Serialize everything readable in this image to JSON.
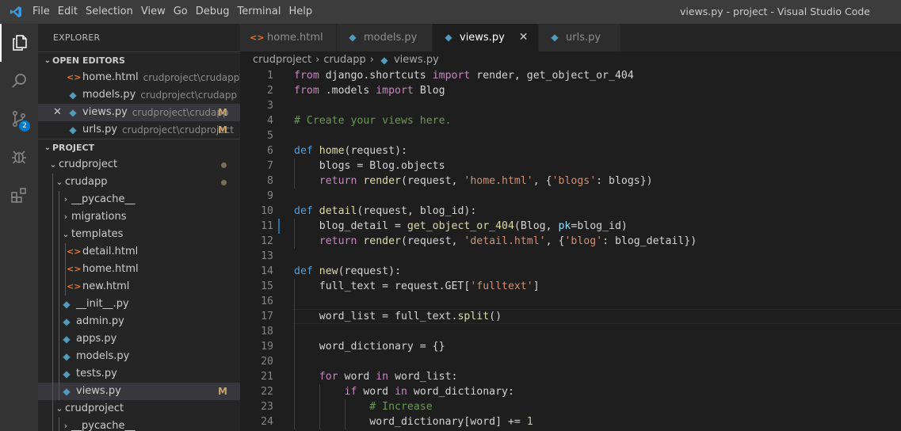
{
  "menu": [
    "File",
    "Edit",
    "Selection",
    "View",
    "Go",
    "Debug",
    "Terminal",
    "Help"
  ],
  "window_title": "views.py - project - Visual Studio Code",
  "activity": {
    "scm_badge": "2"
  },
  "sidebar": {
    "title": "EXPLORER",
    "open_editors_label": "OPEN EDITORS",
    "project_label": "PROJECT",
    "open_editors": [
      {
        "name": "home.html",
        "desc": "crudproject\\crudapp\\te...",
        "icon": "html-icon",
        "mod": "",
        "close": ""
      },
      {
        "name": "models.py",
        "desc": "crudproject\\crudapp",
        "icon": "python-icon",
        "mod": "",
        "close": ""
      },
      {
        "name": "views.py",
        "desc": "crudproject\\crudapp",
        "icon": "python-icon",
        "mod": "M",
        "close": "✕"
      },
      {
        "name": "urls.py",
        "desc": "crudproject\\crudproject",
        "icon": "python-icon",
        "mod": "M",
        "close": ""
      }
    ],
    "tree": [
      {
        "name": "crudproject",
        "chev": "⌄",
        "mod": ""
      },
      {
        "name": "crudapp",
        "chev": "⌄",
        "mod": ""
      },
      {
        "name": "__pycache__",
        "chev": "›",
        "mod": ""
      },
      {
        "name": "migrations",
        "chev": "›",
        "mod": ""
      },
      {
        "name": "templates",
        "chev": "⌄",
        "mod": ""
      },
      {
        "name": "detail.html",
        "chev": "",
        "mod": ""
      },
      {
        "name": "home.html",
        "chev": "",
        "mod": ""
      },
      {
        "name": "new.html",
        "chev": "",
        "mod": ""
      },
      {
        "name": "__init__.py",
        "chev": "",
        "mod": ""
      },
      {
        "name": "admin.py",
        "chev": "",
        "mod": ""
      },
      {
        "name": "apps.py",
        "chev": "",
        "mod": ""
      },
      {
        "name": "models.py",
        "chev": "",
        "mod": ""
      },
      {
        "name": "tests.py",
        "chev": "",
        "mod": ""
      },
      {
        "name": "views.py",
        "chev": "",
        "mod": "M"
      },
      {
        "name": "crudproject",
        "chev": "⌄",
        "mod": ""
      },
      {
        "name": "__pycache__",
        "chev": "›",
        "mod": ""
      }
    ]
  },
  "tabs": [
    {
      "label": "home.html",
      "icon": "html-icon",
      "close": ""
    },
    {
      "label": "models.py",
      "icon": "python-icon",
      "close": ""
    },
    {
      "label": "views.py",
      "icon": "python-icon",
      "close": "✕"
    },
    {
      "label": "urls.py",
      "icon": "python-icon",
      "close": ""
    }
  ],
  "breadcrumb": [
    "crudproject",
    "crudapp",
    "views.py"
  ],
  "editor": {
    "line_numbers": [
      "1",
      "2",
      "3",
      "4",
      "5",
      "6",
      "7",
      "8",
      "9",
      "10",
      "11",
      "12",
      "13",
      "14",
      "15",
      "16",
      "17",
      "18",
      "19",
      "20",
      "21",
      "22",
      "23",
      "24"
    ],
    "lines": [
      "from django.shortcuts import render, get_object_or_404",
      "from .models import Blog",
      "",
      "# Create your views here.",
      "",
      "def home(request):",
      "    blogs = Blog.objects",
      "    return render(request, 'home.html', {'blogs': blogs})",
      "",
      "def detail(request, blog_id):",
      "    blog_detail = get_object_or_404(Blog, pk=blog_id)",
      "    return render(request, 'detail.html', {'blog': blog_detail})",
      "",
      "def new(request):",
      "    full_text = request.GET['fulltext']",
      "",
      "    word_list = full_text.split()",
      "",
      "    word_dictionary = {}",
      "",
      "    for word in word_list:",
      "        if word in word_dictionary:",
      "            # Increase",
      "            word_dictionary[word] += 1"
    ]
  }
}
